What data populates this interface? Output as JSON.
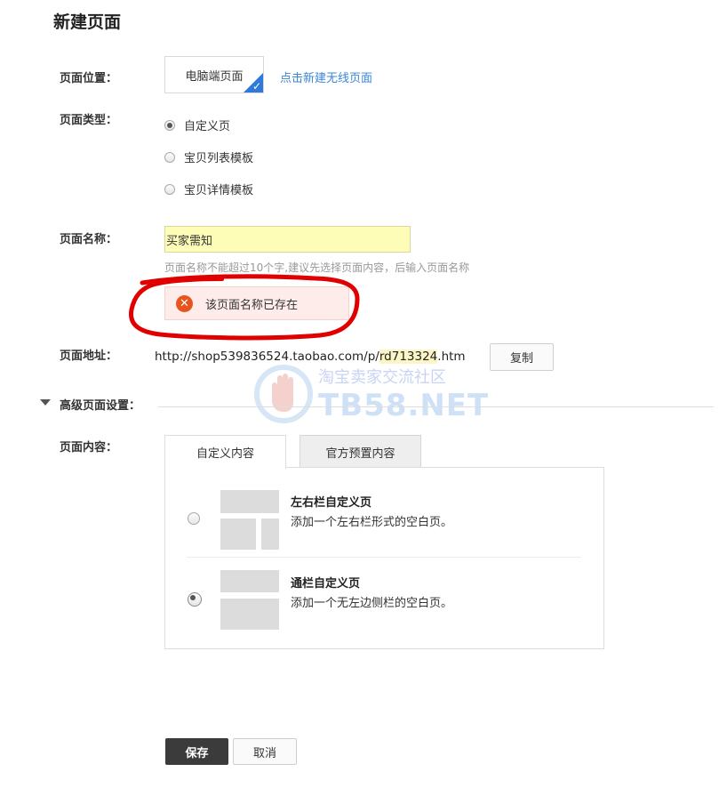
{
  "page_title": "新建页面",
  "location": {
    "label": "页面位置：",
    "selected": "电脑端页面",
    "mobile_link": "点击新建无线页面"
  },
  "page_type": {
    "label": "页面类型：",
    "options": [
      {
        "label": "自定义页",
        "checked": true
      },
      {
        "label": "宝贝列表模板",
        "checked": false
      },
      {
        "label": "宝贝详情模板",
        "checked": false
      }
    ]
  },
  "page_name": {
    "label": "页面名称：",
    "value": "买家需知",
    "hint": "页面名称不能超过10个字,建议先选择页面内容，后输入页面名称",
    "error": "该页面名称已存在"
  },
  "page_url": {
    "label": "页面地址：",
    "prefix": "http://shop539836524.taobao.com/p/",
    "highlight": "rd713324",
    "suffix": ".htm",
    "copy_label": "复制"
  },
  "advanced": {
    "label": "高级页面设置："
  },
  "content": {
    "label": "页面内容：",
    "tabs": [
      {
        "label": "自定义内容",
        "active": true
      },
      {
        "label": "官方预置内容",
        "active": false
      }
    ],
    "options": [
      {
        "title": "左右栏自定义页",
        "desc": "添加一个左右栏形式的空白页。",
        "checked": false
      },
      {
        "title": "通栏自定义页",
        "desc": "添加一个无左边侧栏的空白页。",
        "checked": true
      }
    ]
  },
  "actions": {
    "save": "保存",
    "cancel": "取消"
  },
  "watermark": {
    "line1": "淘宝卖家交流社区",
    "line2": "TB58.NET"
  },
  "colors": {
    "link": "#3a86d8",
    "error_icon": "#e8541e",
    "annotation": "#e00000",
    "check_badge": "#2f7ad7"
  }
}
